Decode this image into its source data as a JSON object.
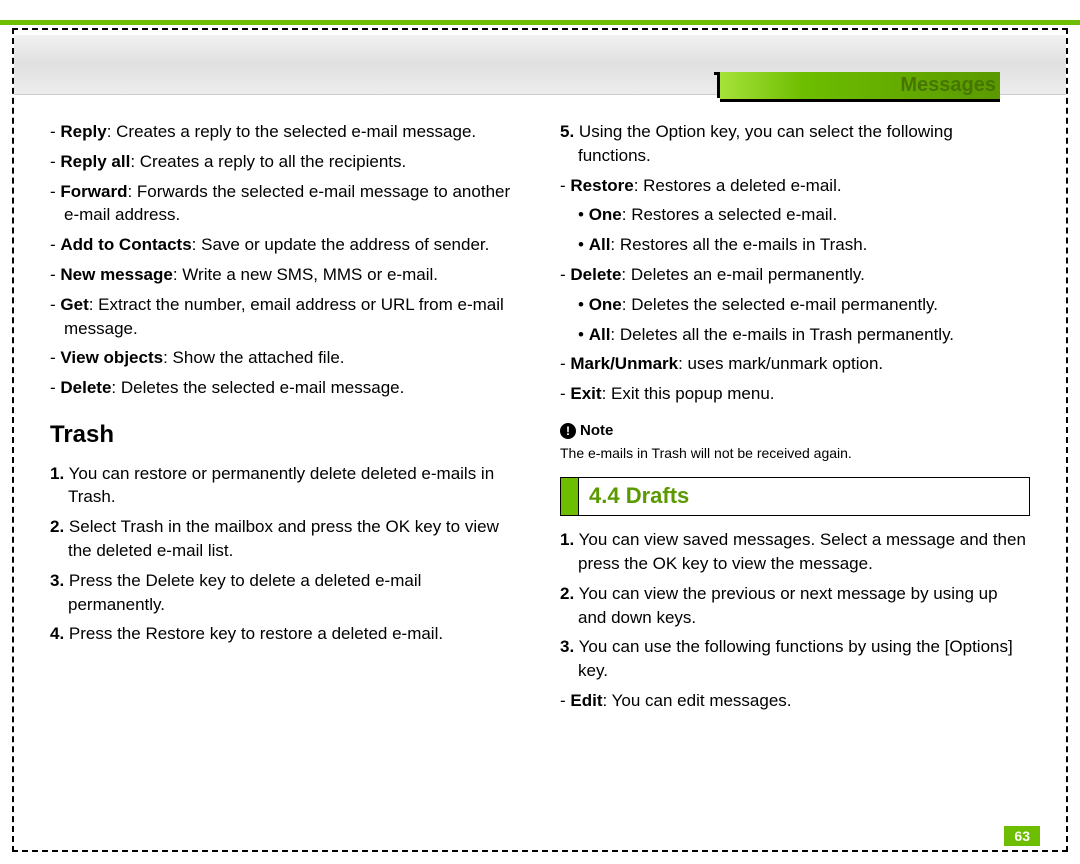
{
  "header": {
    "tab": "Messages"
  },
  "left": {
    "items": [
      {
        "term": "Reply",
        "desc": ": Creates a reply to the selected e-mail message."
      },
      {
        "term": "Reply all",
        "desc": ": Creates a reply to all the recipients."
      },
      {
        "term": "Forward",
        "desc": ": Forwards the selected e-mail message to another e-mail address."
      },
      {
        "term": "Add to Contacts",
        "desc": ": Save or update the address of sender."
      },
      {
        "term": "New message",
        "desc": ": Write a new SMS, MMS or e-mail."
      },
      {
        "term": "Get",
        "desc": ": Extract the number, email address or URL from e-mail message."
      },
      {
        "term": "View objects",
        "desc": ": Show the attached file."
      },
      {
        "term": "Delete",
        "desc": ": Deletes the selected e-mail message."
      }
    ],
    "trash_heading": "Trash",
    "trash_steps": [
      {
        "n": "1.",
        "t": " You can restore or permanently delete deleted e-mails in Trash."
      },
      {
        "n": "2.",
        "t": " Select Trash in the mailbox and press the OK key to view the deleted e-mail list."
      },
      {
        "n": "3.",
        "t": " Press the Delete key to delete a deleted e-mail permanently."
      },
      {
        "n": "4.",
        "t": " Press the Restore key to restore a deleted e-mail."
      }
    ]
  },
  "right": {
    "step5": {
      "n": "5.",
      "t": " Using the Option key, you can select the following functions."
    },
    "opts": [
      {
        "term": "Restore",
        "desc": ": Restores a deleted e-mail.",
        "subs": [
          {
            "term": "One",
            "desc": ": Restores a selected e-mail."
          },
          {
            "term": "All",
            "desc": ": Restores all the e-mails in Trash."
          }
        ]
      },
      {
        "term": "Delete",
        "desc": ": Deletes an e-mail permanently.",
        "subs": [
          {
            "term": "One",
            "desc": ": Deletes the selected e-mail permanently."
          },
          {
            "term": "All",
            "desc": ": Deletes all the e-mails in Trash permanently."
          }
        ]
      },
      {
        "term": "Mark/Unmark",
        "desc": ": uses mark/unmark option."
      },
      {
        "term": "Exit",
        "desc": ": Exit this popup menu."
      }
    ],
    "note_label": "Note",
    "note_text": "The e-mails in Trash will  not be received again.",
    "section": "4.4 Drafts",
    "drafts_steps": [
      {
        "n": "1.",
        "t": " You can view saved messages. Select a message and then press the OK key to view the message."
      },
      {
        "n": "2.",
        "t": " You can view the previous or next message by using up and down keys."
      },
      {
        "n": "3.",
        "t": " You can use the following functions by using the [Options] key."
      }
    ],
    "drafts_opts": [
      {
        "term": "Edit",
        "desc": ": You can edit messages."
      }
    ]
  },
  "page": "63"
}
